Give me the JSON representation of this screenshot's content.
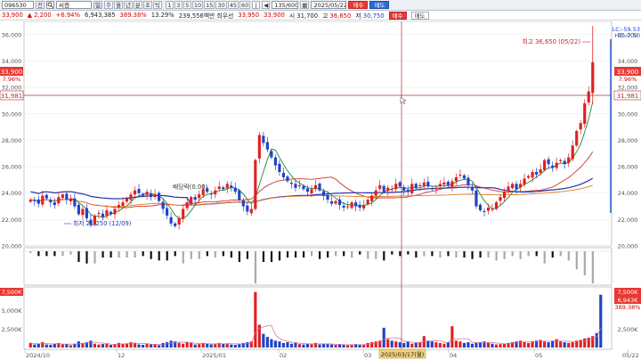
{
  "toolbar": {
    "code": "096530",
    "market_label": "전",
    "name": "씨젠",
    "periods": [
      "주",
      "월",
      "년",
      "분",
      "초",
      "틱"
    ],
    "minute_intervals": [
      "1",
      "3",
      "5",
      "10",
      "15",
      "30",
      "45",
      "60"
    ],
    "count": "135/600",
    "date": "2025/05/22",
    "buy_label": "매수",
    "sell_label": "매도"
  },
  "info": {
    "price": "33,900",
    "change": "2,200",
    "change_pct": "+6.94%",
    "volume": "6,943,385",
    "volume_ratio": "389.38%",
    "turnover": "13.29%",
    "priority_qty": "239,556",
    "priority_label": "백만 최우선",
    "ask": "33,950",
    "bid": "33,900",
    "open_label": "시",
    "open": "31,700",
    "high_label": "고",
    "high": "36,650",
    "low_label": "저",
    "low": "30,750"
  },
  "price_axis": {
    "ticks": [
      "36,000",
      "34,000",
      "32,000",
      "30,000",
      "28,000",
      "26,000",
      "24,000",
      "22,000",
      "20,000"
    ],
    "current_price": "33,900",
    "current_pct": "7.96%",
    "crosshair_price": "31,981",
    "lc_label": "LC:-59.53",
    "hc_label": "HC:-7.50"
  },
  "annotations": {
    "high": "최고 36,650 (05/22)",
    "low": "최저 21,250 (12/09)",
    "marker": "배당락(0.00)"
  },
  "volume_axis": {
    "ticks": [
      "5,000K",
      "2,500K"
    ],
    "top": "7,500K",
    "current_volume": "6,943K",
    "current_pct": "389.38%"
  },
  "time_axis": {
    "labels": [
      "2024/10",
      "12",
      "2025/01",
      "02",
      "03",
      "04",
      "05",
      "05/22"
    ],
    "crosshair_date": "2025/03/17(월)"
  },
  "colors": {
    "up": "#e02020",
    "down": "#1f43c8",
    "ma5": "#1a8a3a",
    "ma20": "#d32f2f",
    "ma60": "#2233aa",
    "ma120": "#e07b20",
    "crosshair": "#b03030"
  },
  "chart_data": {
    "type": "candlestick",
    "x_range": [
      "2024/10",
      "2025/05/22"
    ],
    "y_range": [
      20000,
      37000
    ],
    "closes": [
      23500,
      23400,
      23200,
      23800,
      23600,
      23300,
      23100,
      23700,
      23900,
      23500,
      23600,
      23000,
      22400,
      22800,
      22100,
      21600,
      22300,
      22500,
      22200,
      22700,
      22400,
      22800,
      23100,
      23300,
      23600,
      23900,
      24200,
      24000,
      23800,
      24100,
      23700,
      23900,
      23400,
      22800,
      22300,
      21700,
      21500,
      22100,
      22800,
      23300,
      23700,
      23500,
      23900,
      24300,
      24100,
      23900,
      24200,
      24500,
      24300,
      24700,
      24400,
      24100,
      23500,
      23000,
      22600,
      22800,
      26500,
      28400,
      27800,
      27300,
      26700,
      26100,
      25600,
      25200,
      24900,
      24700,
      24400,
      24600,
      24300,
      24100,
      24300,
      24600,
      24200,
      23800,
      23500,
      23200,
      23400,
      23100,
      22900,
      23000,
      23300,
      23000,
      22900,
      23100,
      23500,
      23800,
      24200,
      24600,
      24100,
      24400,
      24300,
      24700,
      24500,
      24200,
      24100,
      24700,
      24400,
      24600,
      24800,
      24500,
      24300,
      24400,
      24700,
      24800,
      24600,
      24900,
      25200,
      25400,
      25100,
      24600,
      24200,
      23000,
      22700,
      22600,
      22900,
      22800,
      23300,
      23700,
      24100,
      24500,
      24700,
      24300,
      24700,
      25100,
      25300,
      25600,
      25400,
      25800,
      26500,
      26200,
      25900,
      26300,
      26500,
      26200,
      26700,
      27600,
      28700,
      29300,
      30800,
      31700,
      33900
    ],
    "ma_series": [
      {
        "name": "5"
      },
      {
        "name": "20"
      },
      {
        "name": "60"
      },
      {
        "name": "120"
      }
    ],
    "volume_k": [
      600,
      400,
      500,
      700,
      400,
      350,
      500,
      600,
      400,
      450,
      300,
      500,
      800,
      600,
      700,
      900,
      500,
      400,
      450,
      500,
      350,
      400,
      600,
      500,
      550,
      700,
      600,
      400,
      350,
      500,
      400,
      450,
      300,
      600,
      700,
      900,
      800,
      600,
      500,
      700,
      600,
      400,
      450,
      600,
      500,
      400,
      450,
      600,
      500,
      550,
      400,
      350,
      500,
      600,
      700,
      800,
      7300,
      3000,
      1800,
      1400,
      1100,
      900,
      800,
      600,
      700,
      500,
      600,
      450,
      400,
      500,
      450,
      600,
      400,
      500,
      450,
      400,
      350,
      400,
      350,
      300,
      400,
      450,
      350,
      400,
      600,
      700,
      800,
      900,
      2600,
      1100,
      900,
      800,
      700,
      600,
      800,
      500,
      600,
      700,
      1500,
      900,
      800,
      700,
      600,
      500,
      700,
      2800,
      900,
      800,
      600,
      700,
      500,
      600,
      700,
      800,
      600,
      500,
      400,
      450,
      500,
      600,
      700,
      800,
      900,
      700,
      600,
      800,
      900,
      1000,
      800,
      700,
      900,
      1100,
      800,
      700,
      600,
      700,
      900,
      1000,
      1200,
      1300,
      1500,
      1900,
      6943
    ],
    "high": {
      "value": 36650,
      "date": "05/22"
    },
    "low": {
      "value": 21250,
      "date": "12/09"
    }
  }
}
